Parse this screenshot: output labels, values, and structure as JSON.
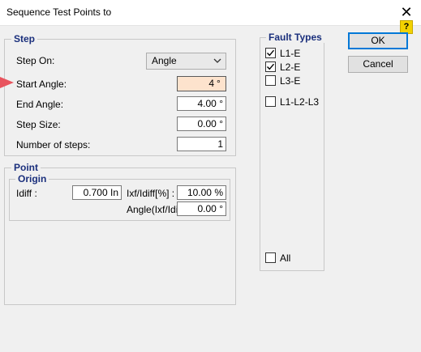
{
  "window": {
    "title": "Sequence Test Points to",
    "close_glyph": "✕",
    "help_glyph": "?"
  },
  "step_group": {
    "title": "Step",
    "step_on_label": "Step On:",
    "step_on_value": "Angle",
    "start_angle_label": "Start Angle:",
    "start_angle_value": "4",
    "start_angle_unit": "°",
    "end_angle_label": "End Angle:",
    "end_angle_value": "4.00 °",
    "step_size_label": "Step Size:",
    "step_size_value": "0.00 °",
    "number_of_steps_label": "Number of steps:",
    "number_of_steps_value": "1"
  },
  "point_group": {
    "title": "Point",
    "origin_title": "Origin",
    "idiff_label": "Idiff :",
    "idiff_value": "0.700 In",
    "ixf_label": "Ixf/Idiff[%] :",
    "ixf_value": "10.00 %",
    "angle_label": "Angle(Ixf/Idiff",
    "angle_value": "0.00 °"
  },
  "fault_types": {
    "title": "Fault Types",
    "items": [
      {
        "label": "L1-E",
        "checked": true
      },
      {
        "label": "L2-E",
        "checked": true
      },
      {
        "label": "L3-E",
        "checked": false
      },
      {
        "label": "L1-L2-L3",
        "checked": false
      }
    ],
    "all_label": "All",
    "all_checked": false
  },
  "buttons": {
    "ok": "OK",
    "cancel": "Cancel"
  },
  "colors": {
    "group_title": "#1a2f7c",
    "active_field": "#fde3cd",
    "help_badge": "#f2d200",
    "pointer_arrow": "#e8545e"
  }
}
